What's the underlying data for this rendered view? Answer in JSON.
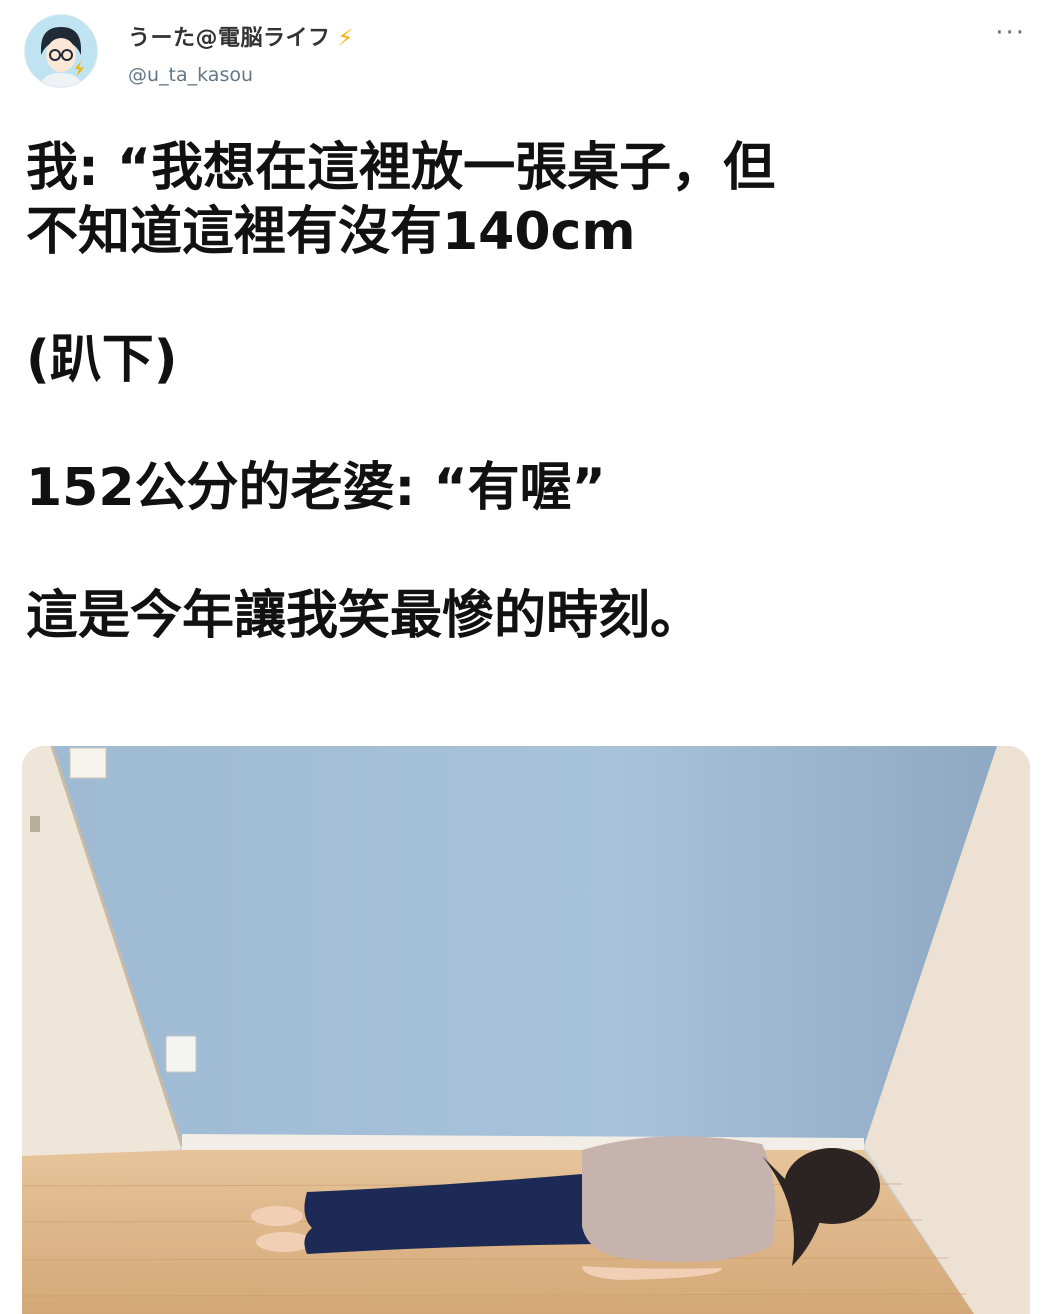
{
  "author": {
    "display_name": "うーた@電脳ライフ",
    "badge_icon": "lightning-bolt-icon",
    "handle": "@u_ta_kasou"
  },
  "menu_icon": "more-options-icon",
  "tweet": {
    "lines": [
      "我: “我想在這裡放一張桌子，但",
      "不知道這裡有沒有140cm",
      "(趴下)",
      "152公分的老婆: “有喔”",
      "這是今年讓我笑最慘的時刻。"
    ]
  },
  "colors": {
    "wall": "#9db9d3",
    "floor": "#d9b48a",
    "handle_text": "#657786",
    "bolt": "#f5b301"
  }
}
